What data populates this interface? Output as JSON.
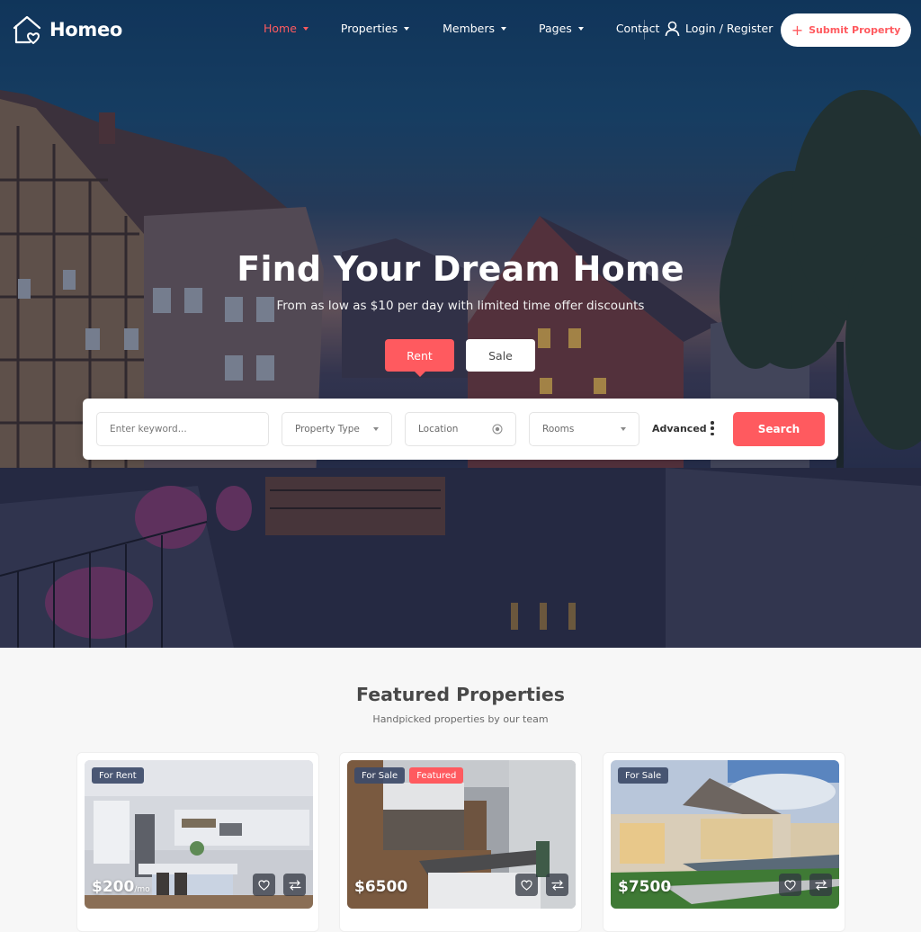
{
  "brand": {
    "name": "Homeo",
    "logo_icon": "house-heart-icon",
    "accent_color": "#ff5a5f"
  },
  "nav": {
    "items": [
      {
        "label": "Home",
        "dropdown": true,
        "active": true
      },
      {
        "label": "Properties",
        "dropdown": true,
        "active": false
      },
      {
        "label": "Members",
        "dropdown": true,
        "active": false
      },
      {
        "label": "Pages",
        "dropdown": true,
        "active": false
      },
      {
        "label": "Contact",
        "dropdown": false,
        "active": false
      }
    ],
    "login_label": "Login / Register",
    "login_icon": "user-icon",
    "submit_label": "Submit Property",
    "submit_icon": "plus-icon"
  },
  "hero": {
    "title": "Find Your Dream Home",
    "subtitle": "From as low as $10 per day with limited time offer discounts",
    "tabs": [
      {
        "label": "Rent",
        "active": true
      },
      {
        "label": "Sale",
        "active": false
      }
    ]
  },
  "search": {
    "keyword_placeholder": "Enter keyword...",
    "property_type": "Property Type",
    "location_placeholder": "Location",
    "location_icon": "target-icon",
    "rooms": "Rooms",
    "advanced_label": "Advanced",
    "advanced_icon": "kebab-icon",
    "search_label": "Search"
  },
  "featured": {
    "title": "Featured Properties",
    "subtitle": "Handpicked properties by our team",
    "cards": [
      {
        "status": "For Rent",
        "featured": false,
        "featured_label": "",
        "price": "$200",
        "price_suffix": "/mo",
        "image": "white-kitchen"
      },
      {
        "status": "For Sale",
        "featured": true,
        "featured_label": "Featured",
        "price": "$6500",
        "price_suffix": "",
        "image": "wood-kitchen"
      },
      {
        "status": "For Sale",
        "featured": false,
        "featured_label": "",
        "price": "$7500",
        "price_suffix": "",
        "image": "villa-pool"
      }
    ],
    "favorite_icon": "heart-icon",
    "compare_icon": "compare-arrows-icon"
  }
}
